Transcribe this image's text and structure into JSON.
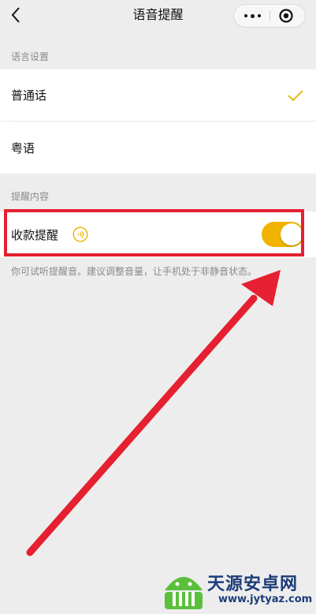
{
  "header": {
    "title": "语音提醒",
    "back_icon": "chevron-left-icon",
    "more_icon": "more-dots-icon",
    "close_icon": "target-close-icon"
  },
  "language_section": {
    "label": "语言设置",
    "options": [
      {
        "label": "普通话",
        "selected": true
      },
      {
        "label": "粤语",
        "selected": false
      }
    ],
    "check_icon": "checkmark-icon",
    "check_color": "#e8b400"
  },
  "content_section": {
    "label": "提醒内容",
    "payment_alert": {
      "label": "收款提醒",
      "sound_icon": "sound-wave-icon",
      "enabled": true,
      "toggle_color": "#f0b400"
    },
    "hint": "你可试听提醒音。建议调整音量，让手机处于非静音状态。"
  },
  "annotation": {
    "color": "#e52030"
  },
  "watermark": {
    "name": "天源安卓网",
    "url": "www.jytyaz.com"
  }
}
